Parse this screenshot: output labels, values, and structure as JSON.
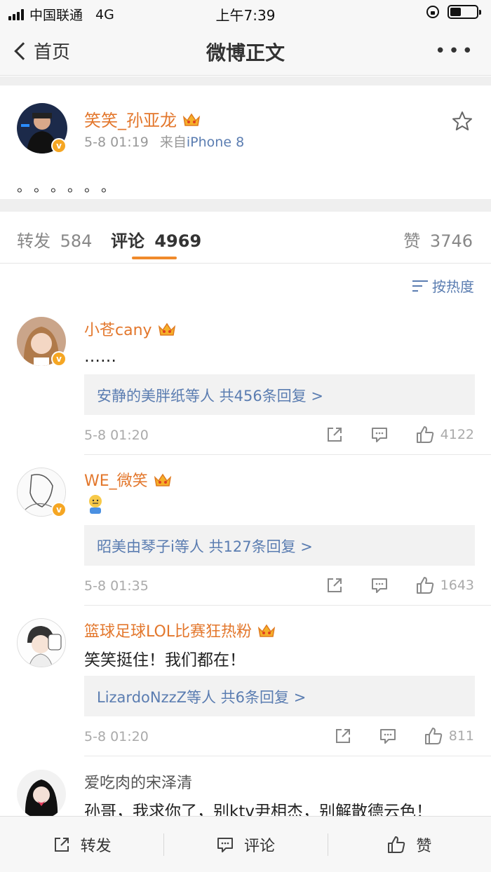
{
  "status_bar": {
    "carrier": "中国联通",
    "network": "4G",
    "time": "上午7:39"
  },
  "nav": {
    "back_label": "首页",
    "title": "微博正文"
  },
  "post": {
    "author": "笑笑_孙亚龙",
    "time": "5-8 01:19",
    "source_prefix": "来自",
    "source": "iPhone 8",
    "body": "。。。。。。"
  },
  "tabs": {
    "repost_label": "转发",
    "repost_count": "584",
    "comment_label": "评论",
    "comment_count": "4969",
    "like_label": "赞",
    "like_count": "3746"
  },
  "sort_label": "按热度",
  "comments": [
    {
      "name": "小苍cany",
      "text": "……",
      "reply": "安静的美胖纸等人  共456条回复 >",
      "time": "5-8 01:20",
      "likes": "4122"
    },
    {
      "name": "WE_微笑",
      "text": "",
      "reply": "昭美由琴子i等人  共127条回复 >",
      "time": "5-8 01:35",
      "likes": "1643"
    },
    {
      "name": "篮球足球LOL比赛狂热粉",
      "text": "笑笑挺住！我们都在！",
      "reply": "LizardoNzzZ等人  共6条回复 >",
      "time": "5-8 01:20",
      "likes": "811"
    },
    {
      "name": "爱吃肉的宋泽清",
      "text": "孙哥，我求你了，别ktv尹相杰，别解散德云色！"
    }
  ],
  "bottom_bar": {
    "repost": "转发",
    "comment": "评论",
    "like": "赞"
  },
  "colors": {
    "accent": "#f08a2b",
    "name": "#e3772c",
    "link": "#5b7db1",
    "vip": "#f5a623"
  }
}
